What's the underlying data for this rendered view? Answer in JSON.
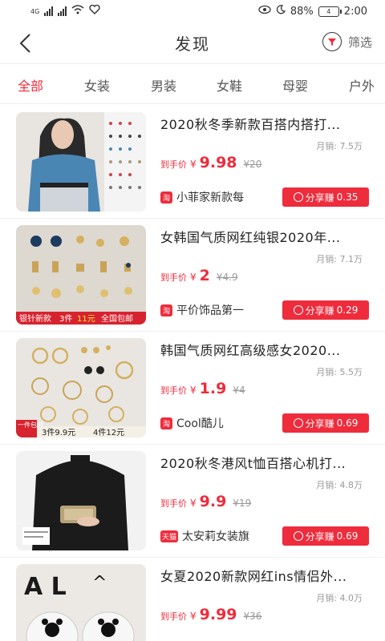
{
  "status_bar": {
    "left_label": "4G",
    "battery_percent": "88%",
    "battery_label": "4",
    "time": "2:00"
  },
  "header": {
    "title": "发现",
    "filter_label": "筛选"
  },
  "tabs": [
    "全部",
    "女装",
    "男装",
    "女鞋",
    "母婴",
    "户外"
  ],
  "labels": {
    "sales_prefix": "月销: ",
    "price_tag": "到手价",
    "currency": "¥",
    "share_label": "分享赚 "
  },
  "products": [
    {
      "title": "2020秋冬季新款百搭内搭打...",
      "sales": "7.5万",
      "price": "9.98",
      "original_price": "¥20",
      "shop": "小菲家新款每",
      "share_amount": "0.35"
    },
    {
      "title": "女韩国气质网红纯银2020年...",
      "sales": "7.1万",
      "price": "2",
      "original_price": "¥4.9",
      "shop": "平价饰品第一",
      "share_amount": "0.29",
      "image_banner": [
        "银针新款",
        "3件",
        "11元",
        "全国包邮"
      ]
    },
    {
      "title": "韩国气质网红高级感女2020...",
      "sales": "5.5万",
      "price": "1.9",
      "original_price": "¥4",
      "shop": "Cool酷儿",
      "share_amount": "0.69",
      "image_banner": [
        "一件包邮",
        "3件9.9元",
        "4件12元"
      ]
    },
    {
      "title": "2020秋冬港风t恤百搭心机打...",
      "sales": "4.8万",
      "price": "9.9",
      "original_price": "¥19",
      "shop": "太安莉女装旗",
      "share_amount": "0.69"
    },
    {
      "title": "女夏2020新款网红ins情侣外...",
      "sales": "4.0万",
      "price": "9.99",
      "original_price": "¥36",
      "shop": "",
      "share_amount": ""
    }
  ],
  "colors": {
    "accent": "#ee2c3c"
  }
}
